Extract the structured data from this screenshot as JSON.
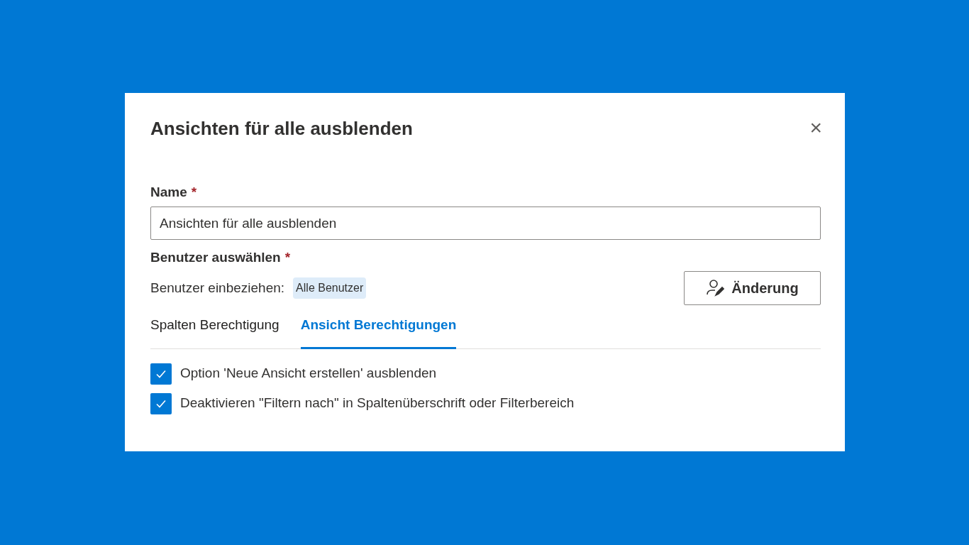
{
  "dialog": {
    "title": "Ansichten für alle ausblenden",
    "close_icon": "×"
  },
  "name_field": {
    "label": "Name",
    "required_mark": "*",
    "value": "Ansichten für alle ausblenden"
  },
  "users": {
    "label": "Benutzer auswählen",
    "required_mark": "*",
    "include_label": "Benutzer einbeziehen:",
    "tag": "Alle Benutzer",
    "change_button": "Änderung"
  },
  "tabs": [
    {
      "label": "Spalten Berechtigung",
      "selected": false
    },
    {
      "label": "Ansicht Berechtigungen",
      "selected": true
    }
  ],
  "options": [
    {
      "label": "Option 'Neue Ansicht erstellen' ausblenden",
      "checked": true
    },
    {
      "label": "Deaktivieren \"Filtern nach\" in Spaltenüberschrift oder Filterbereich",
      "checked": true
    }
  ]
}
